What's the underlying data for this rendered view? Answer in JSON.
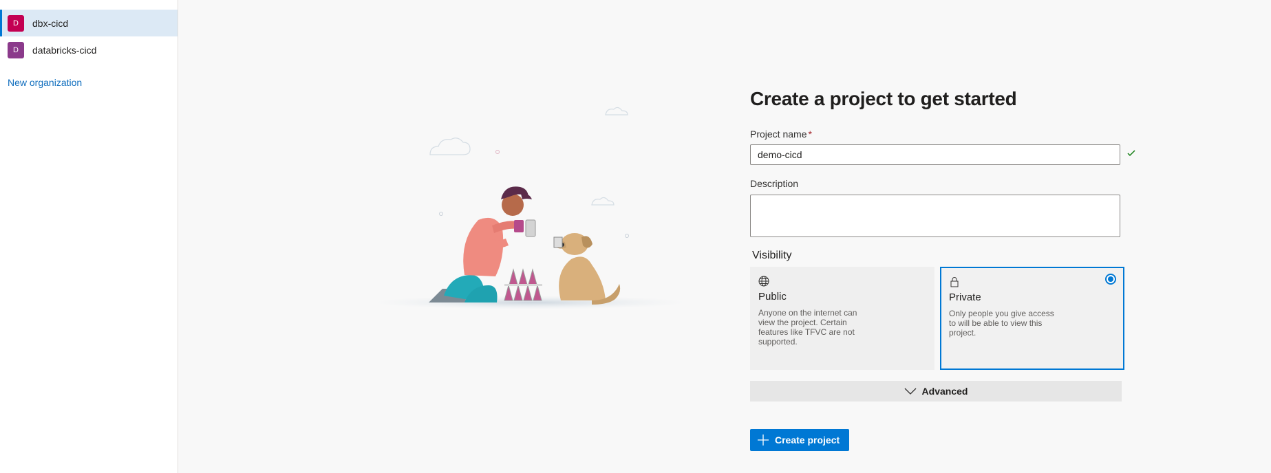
{
  "sidebar": {
    "organizations": [
      {
        "initial": "D",
        "name": "dbx-cicd",
        "color": "#c30052",
        "selected": true
      },
      {
        "initial": "D",
        "name": "databricks-cicd",
        "color": "#8b3a8b",
        "selected": false
      }
    ],
    "new_org_label": "New organization"
  },
  "form": {
    "title": "Create a project to get started",
    "project_name_label": "Project name",
    "required_marker": "*",
    "project_name_value": "demo-cicd",
    "description_label": "Description",
    "description_value": "",
    "visibility_label": "Visibility",
    "visibility_options": [
      {
        "title": "Public",
        "description": "Anyone on the internet can view the project. Certain features like TFVC are not supported.",
        "icon": "globe-icon",
        "selected": false
      },
      {
        "title": "Private",
        "description": "Only people you give access to will be able to view this project.",
        "icon": "lock-icon",
        "selected": true
      }
    ],
    "advanced_label": "Advanced",
    "create_button_label": "Create project"
  },
  "colors": {
    "accent": "#0078d4",
    "success": "#107c10"
  }
}
